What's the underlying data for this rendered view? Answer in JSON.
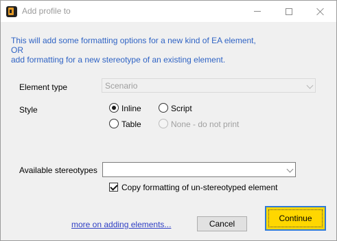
{
  "window": {
    "title": "Add profile to",
    "controls": {
      "minimize": "minimize",
      "maximize": "maximize",
      "close": "close"
    }
  },
  "intro": {
    "line1": "This will add some formatting options for a new kind of EA element,",
    "line2": "OR",
    "line3": "add formatting for a new stereotype of an existing element."
  },
  "form": {
    "element_type_label": "Element type",
    "element_type_value": "Scenario",
    "style_label": "Style",
    "style_options": [
      {
        "label": "Inline",
        "checked": true,
        "disabled": false
      },
      {
        "label": "Script",
        "checked": false,
        "disabled": false
      },
      {
        "label": "Table",
        "checked": false,
        "disabled": false
      },
      {
        "label": "None - do not print",
        "checked": false,
        "disabled": true
      }
    ],
    "stereotypes_label": "Available stereotypes",
    "stereotypes_value": "",
    "copy_formatting_label": "Copy formatting of un-stereotyped element",
    "copy_formatting_checked": true
  },
  "footer": {
    "link": "more on adding elements...",
    "cancel": "Cancel",
    "continue": "Continue"
  },
  "colors": {
    "intro_text": "#2f63c4",
    "link": "#2f3fc4",
    "continue_bg": "#ffd700",
    "continue_border": "#2f7ad6"
  }
}
